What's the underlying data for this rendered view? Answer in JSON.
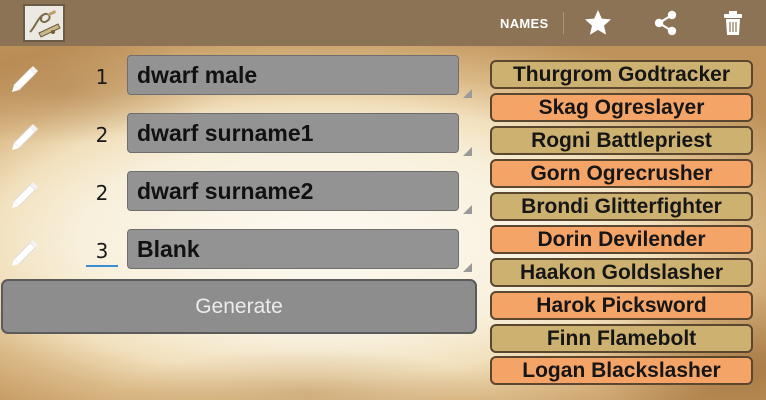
{
  "topbar": {
    "tab_label": "NAMES",
    "app_icon": "parchment-scroll-icon",
    "actions": [
      {
        "name": "star-icon"
      },
      {
        "name": "share-icon"
      },
      {
        "name": "trash-icon"
      }
    ]
  },
  "generators": [
    {
      "count": "1",
      "type": "dwarf male"
    },
    {
      "count": "2",
      "type": "dwarf surname1"
    },
    {
      "count": "2",
      "type": "dwarf surname2"
    },
    {
      "count": "3",
      "type": "Blank"
    }
  ],
  "generate_label": "Generate",
  "results": [
    "Thurgrom Godtracker",
    "Skag Ogreslayer",
    "Rogni Battlepriest",
    "Gorn Ogrecrusher",
    "Brondi Glitterfighter",
    "Dorin Devilender",
    "Haakon Goldslasher",
    "Harok Picksword",
    "Finn Flamebolt",
    "Logan Blackslasher"
  ],
  "colors": {
    "topbar": "#8c7356",
    "result_gold": "#cdb171",
    "result_orange": "#f5a468",
    "input_grey": "#939393",
    "focus_blue": "#3a8fd0"
  }
}
